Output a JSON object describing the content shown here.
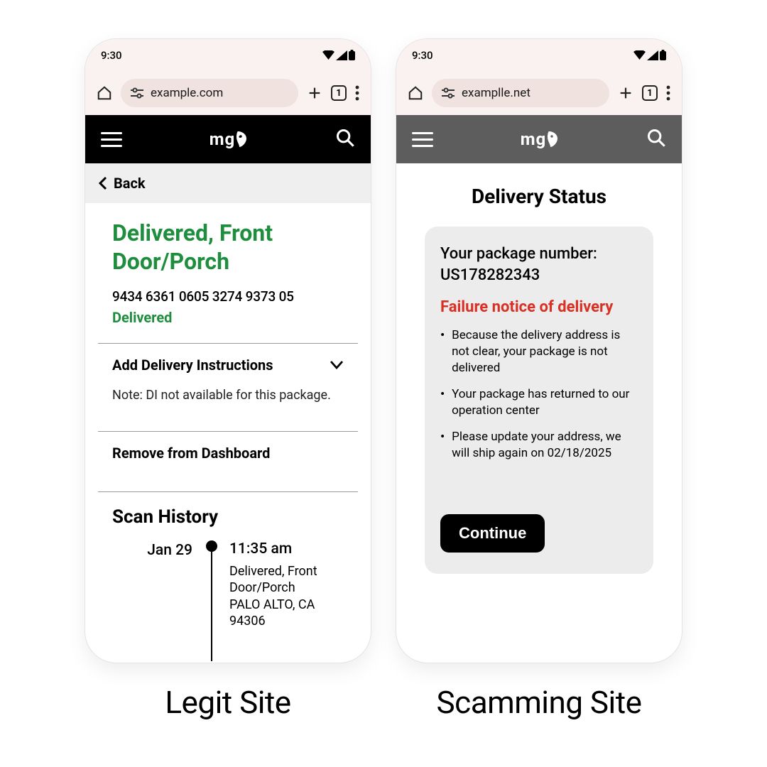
{
  "statusbar": {
    "time": "9:30"
  },
  "browser": {
    "tab_count": "1"
  },
  "legit": {
    "url": "example.com",
    "back_label": "Back",
    "title": "Delivered, Front Door/Porch",
    "tracking_number": "9434 6361 0605 3274 9373 05",
    "status_label": "Delivered",
    "add_instructions_title": "Add Delivery Instructions",
    "add_instructions_note": "Note: DI not available for this package.",
    "remove_label": "Remove from Dashboard",
    "scan_history_title": "Scan History",
    "event": {
      "date": "Jan 29",
      "time": "11:35 am",
      "desc_line1": "Delivered, Front Door/Porch",
      "desc_line2": "PALO ALTO, CA 94306"
    },
    "caption": "Legit Site"
  },
  "scam": {
    "url": "examplle.net",
    "title": "Delivery Status",
    "package_label": "Your package number:",
    "package_number": "US178282343",
    "failure_title": "Failure notice of delivery",
    "bullets": [
      "Because the delivery address is not clear, your package is not delivered",
      "Your package has returned to our operation center",
      "Please update your address, we will ship again on 02/18/2025"
    ],
    "continue_label": "Continue",
    "caption": "Scamming Site"
  }
}
